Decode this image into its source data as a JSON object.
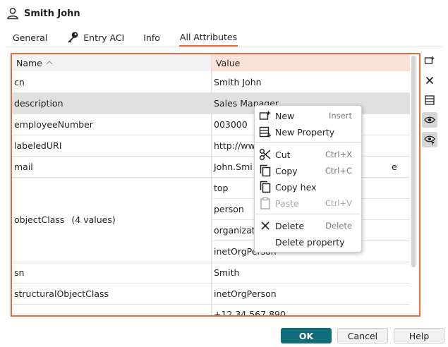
{
  "title": "Smith John",
  "tabs": [
    {
      "label": "General"
    },
    {
      "label": "Entry ACI"
    },
    {
      "label": "Info"
    },
    {
      "label": "All Attributes",
      "active": true
    }
  ],
  "table": {
    "col_name": "Name",
    "col_value": "Value",
    "rows": [
      {
        "name": "cn",
        "value": "Smith John"
      },
      {
        "name": "description",
        "value": "Sales Manager"
      },
      {
        "name": "employeeNumber",
        "value": "003000"
      },
      {
        "name": "labeledURI",
        "value": "http://ww"
      },
      {
        "name": "mail",
        "value": "John.Smi"
      },
      {
        "name": "objectClass",
        "count": "(4 values)",
        "values": [
          "top",
          "person",
          "organizat",
          "inetOrgPerson"
        ]
      },
      {
        "name": "sn",
        "value": "Smith"
      },
      {
        "name": "structuralObjectClass",
        "value": "inetOrgPerson"
      },
      {
        "name": "",
        "value": "+12 34 567 890"
      }
    ],
    "mail_tail": "e"
  },
  "menu": {
    "items": [
      {
        "label": "New",
        "shortcut": "Insert",
        "icon": "new-attribute-icon"
      },
      {
        "label": "New Property",
        "shortcut": "",
        "icon": "new-property-icon"
      },
      {
        "label": "Cut",
        "shortcut": "Ctrl+X",
        "icon": "scissors-icon"
      },
      {
        "label": "Copy",
        "shortcut": "Ctrl+C",
        "icon": "copy-icon"
      },
      {
        "label": "Copy hex",
        "shortcut": "",
        "icon": "copy-hex-icon"
      },
      {
        "label": "Paste",
        "shortcut": "Ctrl+V",
        "icon": "clipboard-icon",
        "disabled": true
      },
      {
        "label": "Delete",
        "shortcut": "Delete",
        "icon": "close-icon"
      },
      {
        "label": "Delete property",
        "shortcut": "",
        "icon": ""
      }
    ]
  },
  "buttons": {
    "ok": "OK",
    "cancel": "Cancel",
    "help": "Help"
  },
  "colors": {
    "accent": "#e26d40",
    "primary": "#0f6e7a",
    "header_value_bg": "#fbe2d8",
    "selected_row": "#e0e0e0"
  }
}
